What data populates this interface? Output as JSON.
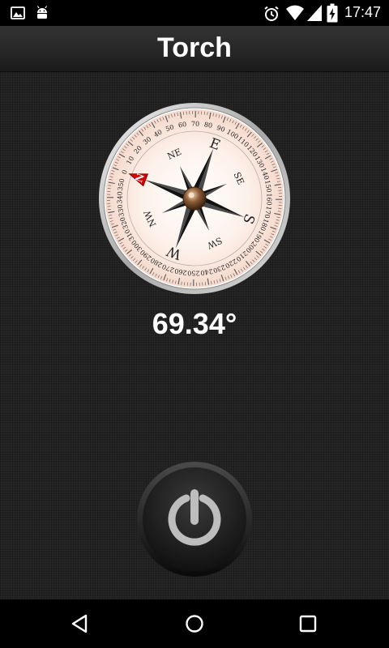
{
  "status_bar": {
    "time": "17:47",
    "icons": [
      "image-icon",
      "android-icon",
      "alarm-icon",
      "wifi-icon",
      "signal-icon",
      "battery-charging-icon"
    ]
  },
  "app": {
    "title": "Torch"
  },
  "compass": {
    "heading_text": "69.34°",
    "cardinal_labels": [
      "N",
      "NE",
      "E",
      "SE",
      "S",
      "SW",
      "W",
      "NW"
    ],
    "degree_labels": [
      "0",
      "10",
      "20",
      "30",
      "40",
      "50",
      "60",
      "70",
      "80",
      "90",
      "100",
      "110",
      "120",
      "130",
      "140",
      "150",
      "160",
      "170",
      "180",
      "190",
      "200",
      "210",
      "220",
      "230",
      "240",
      "250",
      "260",
      "270",
      "280",
      "290",
      "300",
      "310",
      "320",
      "330",
      "340",
      "350"
    ]
  },
  "controls": {
    "power_button_icon": "power-icon"
  },
  "nav_bar": {
    "buttons": [
      "back-icon",
      "home-icon",
      "recents-icon"
    ]
  },
  "colors": {
    "background": "#222222",
    "title_bar": "#2a2a2a",
    "compass_face": "#fbe9df",
    "north_marker": "#d40000",
    "text": "#ffffff"
  }
}
